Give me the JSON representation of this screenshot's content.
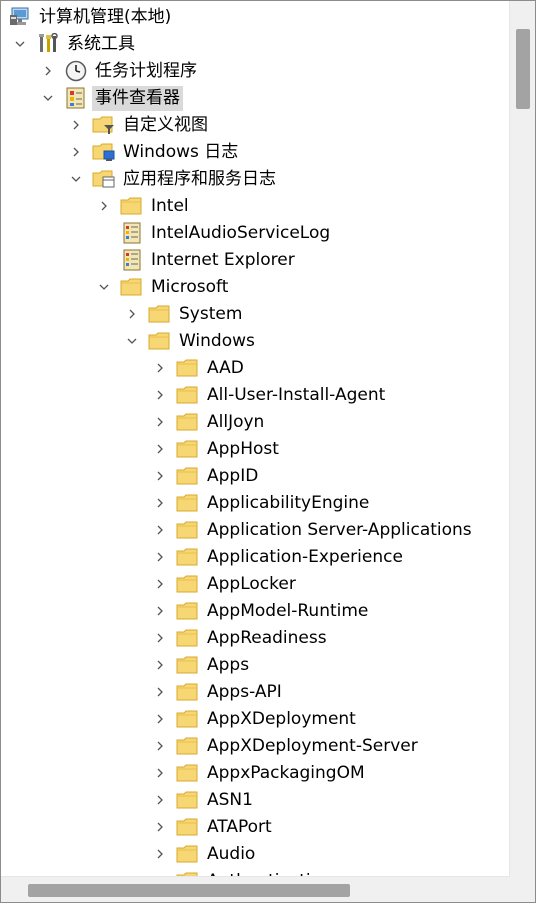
{
  "tree": {
    "root": "计算机管理(本地)",
    "system_tools": "系统工具",
    "task_scheduler": "任务计划程序",
    "event_viewer": "事件查看器",
    "custom_views": "自定义视图",
    "windows_logs": "Windows 日志",
    "app_service_logs": "应用程序和服务日志",
    "intel": "Intel",
    "intel_audio": "IntelAudioServiceLog",
    "internet_explorer": "Internet Explorer",
    "microsoft": "Microsoft",
    "system": "System",
    "windows": "Windows",
    "windows_children": [
      "AAD",
      "All-User-Install-Agent",
      "AllJoyn",
      "AppHost",
      "AppID",
      "ApplicabilityEngine",
      "Application Server-Applications",
      "Application-Experience",
      "AppLocker",
      "AppModel-Runtime",
      "AppReadiness",
      "Apps",
      "Apps-API",
      "AppXDeployment",
      "AppXDeployment-Server",
      "AppxPackagingOM",
      "ASN1",
      "ATAPort",
      "Audio",
      "Authentication"
    ]
  },
  "selected": "事件查看器",
  "colors": {
    "folder_fill": "#f7d774",
    "folder_stroke": "#d9a82e",
    "selection_bg": "#dadada",
    "scroll_thumb": "#a3a3a3",
    "scroll_track": "#f0f0f0"
  },
  "icons": {
    "collapsed": "chevron-right-icon",
    "expanded": "chevron-down-icon",
    "root": "computer-management-icon",
    "tools": "tools-icon",
    "clock": "clock-icon",
    "event_viewer": "event-viewer-icon",
    "folder": "folder-icon",
    "log": "log-icon"
  }
}
